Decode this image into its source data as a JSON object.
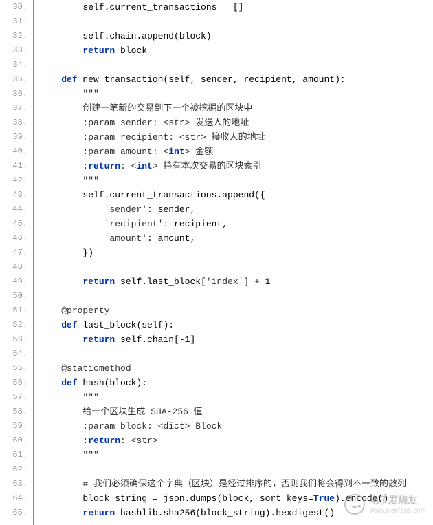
{
  "lines": [
    {
      "num": 30,
      "indent": 2,
      "tokens": [
        {
          "t": "self.current_transactions = []",
          "c": ""
        }
      ]
    },
    {
      "num": 31,
      "indent": 0,
      "tokens": []
    },
    {
      "num": 32,
      "indent": 2,
      "tokens": [
        {
          "t": "self.chain.append(block)",
          "c": ""
        }
      ]
    },
    {
      "num": 33,
      "indent": 2,
      "tokens": [
        {
          "t": "return",
          "c": "kw"
        },
        {
          "t": " block",
          "c": ""
        }
      ]
    },
    {
      "num": 34,
      "indent": 0,
      "tokens": []
    },
    {
      "num": 35,
      "indent": 1,
      "tokens": [
        {
          "t": "def",
          "c": "kw"
        },
        {
          "t": " new_transaction(self, sender, recipient, amount):",
          "c": ""
        }
      ]
    },
    {
      "num": 36,
      "indent": 2,
      "tokens": [
        {
          "t": "\"\"\"",
          "c": "str"
        }
      ]
    },
    {
      "num": 37,
      "indent": 2,
      "tokens": [
        {
          "t": "创建一笔新的交易到下一个被挖掘的区块中",
          "c": "str"
        }
      ]
    },
    {
      "num": 38,
      "indent": 2,
      "tokens": [
        {
          "t": ":param sender: <str> 发送人的地址",
          "c": "str"
        }
      ]
    },
    {
      "num": 39,
      "indent": 2,
      "tokens": [
        {
          "t": ":param recipient: <str> 接收人的地址",
          "c": "str"
        }
      ]
    },
    {
      "num": 40,
      "indent": 2,
      "tokens": [
        {
          "t": ":param amount: <",
          "c": "str"
        },
        {
          "t": "int",
          "c": "kw"
        },
        {
          "t": "> 金额",
          "c": "str"
        }
      ]
    },
    {
      "num": 41,
      "indent": 2,
      "tokens": [
        {
          "t": ":",
          "c": "str"
        },
        {
          "t": "return",
          "c": "kw"
        },
        {
          "t": ": <",
          "c": "str"
        },
        {
          "t": "int",
          "c": "kw"
        },
        {
          "t": "> 持有本次交易的区块索引",
          "c": "str"
        }
      ]
    },
    {
      "num": 42,
      "indent": 2,
      "tokens": [
        {
          "t": "\"\"\"",
          "c": "str"
        }
      ]
    },
    {
      "num": 43,
      "indent": 2,
      "tokens": [
        {
          "t": "self.current_transactions.append({",
          "c": ""
        }
      ]
    },
    {
      "num": 44,
      "indent": 3,
      "tokens": [
        {
          "t": "'sender'",
          "c": "str"
        },
        {
          "t": ": sender,",
          "c": ""
        }
      ]
    },
    {
      "num": 45,
      "indent": 3,
      "tokens": [
        {
          "t": "'recipient'",
          "c": "str"
        },
        {
          "t": ": recipient,",
          "c": ""
        }
      ]
    },
    {
      "num": 46,
      "indent": 3,
      "tokens": [
        {
          "t": "'amount'",
          "c": "str"
        },
        {
          "t": ": amount,",
          "c": ""
        }
      ]
    },
    {
      "num": 47,
      "indent": 2,
      "tokens": [
        {
          "t": "})",
          "c": ""
        }
      ]
    },
    {
      "num": 48,
      "indent": 0,
      "tokens": []
    },
    {
      "num": 49,
      "indent": 2,
      "tokens": [
        {
          "t": "return",
          "c": "kw"
        },
        {
          "t": " self.last_block[",
          "c": ""
        },
        {
          "t": "'index'",
          "c": "str"
        },
        {
          "t": "] + 1",
          "c": ""
        }
      ]
    },
    {
      "num": 50,
      "indent": 0,
      "tokens": []
    },
    {
      "num": 51,
      "indent": 1,
      "tokens": [
        {
          "t": "@property",
          "c": "decorator"
        }
      ]
    },
    {
      "num": 52,
      "indent": 1,
      "tokens": [
        {
          "t": "def",
          "c": "kw"
        },
        {
          "t": " last_block(self):",
          "c": ""
        }
      ]
    },
    {
      "num": 53,
      "indent": 2,
      "tokens": [
        {
          "t": "return",
          "c": "kw"
        },
        {
          "t": " self.chain[-1]",
          "c": ""
        }
      ]
    },
    {
      "num": 54,
      "indent": 0,
      "tokens": []
    },
    {
      "num": 55,
      "indent": 1,
      "tokens": [
        {
          "t": "@staticmethod",
          "c": "decorator"
        }
      ]
    },
    {
      "num": 56,
      "indent": 1,
      "tokens": [
        {
          "t": "def",
          "c": "kw"
        },
        {
          "t": " hash(block):",
          "c": ""
        }
      ]
    },
    {
      "num": 57,
      "indent": 2,
      "tokens": [
        {
          "t": "\"\"\"",
          "c": "str"
        }
      ]
    },
    {
      "num": 58,
      "indent": 2,
      "tokens": [
        {
          "t": "给一个区块生成 SHA-256 值",
          "c": "str"
        }
      ]
    },
    {
      "num": 59,
      "indent": 2,
      "tokens": [
        {
          "t": ":param block: <dict> Block",
          "c": "str"
        }
      ]
    },
    {
      "num": 60,
      "indent": 2,
      "tokens": [
        {
          "t": ":",
          "c": "str"
        },
        {
          "t": "return",
          "c": "kw"
        },
        {
          "t": ": <str>",
          "c": "str"
        }
      ]
    },
    {
      "num": 61,
      "indent": 2,
      "tokens": [
        {
          "t": "\"\"\"",
          "c": "str"
        }
      ]
    },
    {
      "num": 62,
      "indent": 0,
      "tokens": []
    },
    {
      "num": 63,
      "indent": 2,
      "tokens": [
        {
          "t": "# 我们必须确保这个字典（区块）是经过排序的，否则我们将会得到不一致的散列",
          "c": "str"
        }
      ]
    },
    {
      "num": 64,
      "indent": 2,
      "tokens": [
        {
          "t": "block_string = json.dumps(block, sort_keys=",
          "c": ""
        },
        {
          "t": "True",
          "c": "kw"
        },
        {
          "t": ").encode()",
          "c": ""
        }
      ]
    },
    {
      "num": 65,
      "indent": 2,
      "tokens": [
        {
          "t": "return",
          "c": "kw"
        },
        {
          "t": " hashlib.sha256(block_string).hexdigest()",
          "c": ""
        }
      ]
    }
  ],
  "indentSize": "    ",
  "watermark": {
    "main": "电子发烧友",
    "sub": "www.elecfans.com"
  }
}
